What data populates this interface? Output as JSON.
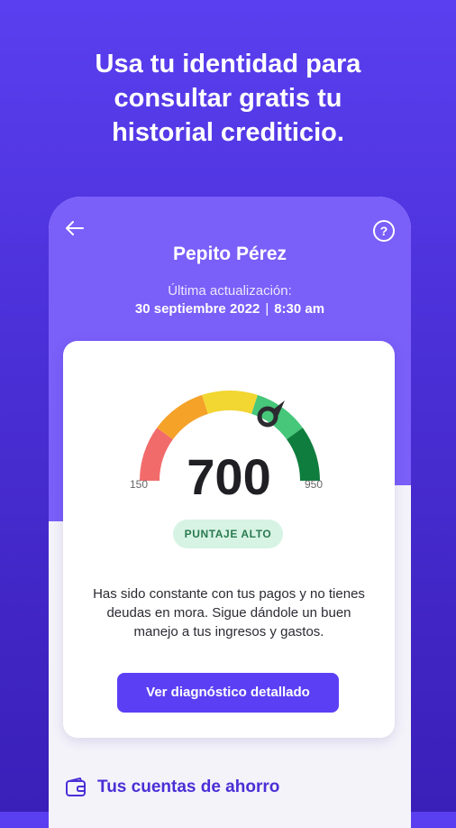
{
  "headline": {
    "line1": "Usa tu identidad para",
    "line2": "consultar gratis tu",
    "line3": "historial crediticio."
  },
  "header": {
    "back_icon": "arrow-left-icon",
    "help_icon": "question-circle-icon",
    "help_glyph": "?",
    "name": "Pepito Pérez",
    "updated_label": "Última actualización:",
    "updated_date": "30 septiembre 2022",
    "updated_separator": "|",
    "updated_time": "8:30 am"
  },
  "score_card": {
    "score": "700",
    "min": "150",
    "max": "950",
    "level": "PUNTAJE ALTO",
    "description": "Has sido constante con tus pagos y no tienes deudas en mora. Sigue dándole un buen manejo a tus ingresos y gastos.",
    "cta_label": "Ver diagnóstico detallado",
    "gauge_colors": [
      "#f26b6b",
      "#f5a229",
      "#f2d631",
      "#46c77a",
      "#0f7d3d"
    ]
  },
  "savings": {
    "icon": "wallet-icon",
    "title": "Tus cuentas de ahorro"
  },
  "colors": {
    "brand": "#5b3ff5",
    "header_bg": "#7a5ff9",
    "badge_bg": "#d7f3e4",
    "badge_text": "#2a7a50"
  }
}
